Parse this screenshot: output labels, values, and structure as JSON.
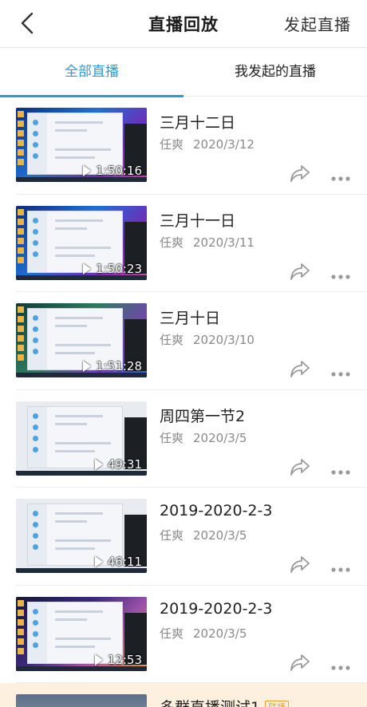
{
  "header": {
    "back_icon": "chevron-left-icon",
    "title": "直播回放",
    "start_live_label": "发起直播"
  },
  "tabs": [
    {
      "label": "全部直播",
      "selected": true
    },
    {
      "label": "我发起的直播",
      "selected": false
    }
  ],
  "colors": {
    "accent": "#2f9ad6",
    "live_banner_bg": "#fdf0df",
    "badge": "#f0a020"
  },
  "replays": [
    {
      "title": "三月十二日",
      "author": "任爽",
      "date": "2020/3/12",
      "duration": "1:50:16",
      "thumb_style": "t-blue"
    },
    {
      "title": "三月十一日",
      "author": "任爽",
      "date": "2020/3/11",
      "duration": "1:50:23",
      "thumb_style": "t-blue"
    },
    {
      "title": "三月十日",
      "author": "任爽",
      "date": "2020/3/10",
      "duration": "1:51:28",
      "thumb_style": "t-green"
    },
    {
      "title": "周四第一节2",
      "author": "任爽",
      "date": "2020/3/5",
      "duration": "49:31",
      "thumb_style": "t-light"
    },
    {
      "title": "2019-2020-2-3",
      "author": "任爽",
      "date": "2020/3/5",
      "duration": "46:11",
      "thumb_style": "t-light"
    },
    {
      "title": "2019-2020-2-3",
      "author": "任爽",
      "date": "2020/3/5",
      "duration": "12:53",
      "thumb_style": "t-city"
    }
  ],
  "live_item": {
    "title": "多群直播测试1",
    "badge": "联播"
  },
  "icons": {
    "share": "share-icon",
    "more": "more-icon",
    "play": "play-icon"
  }
}
